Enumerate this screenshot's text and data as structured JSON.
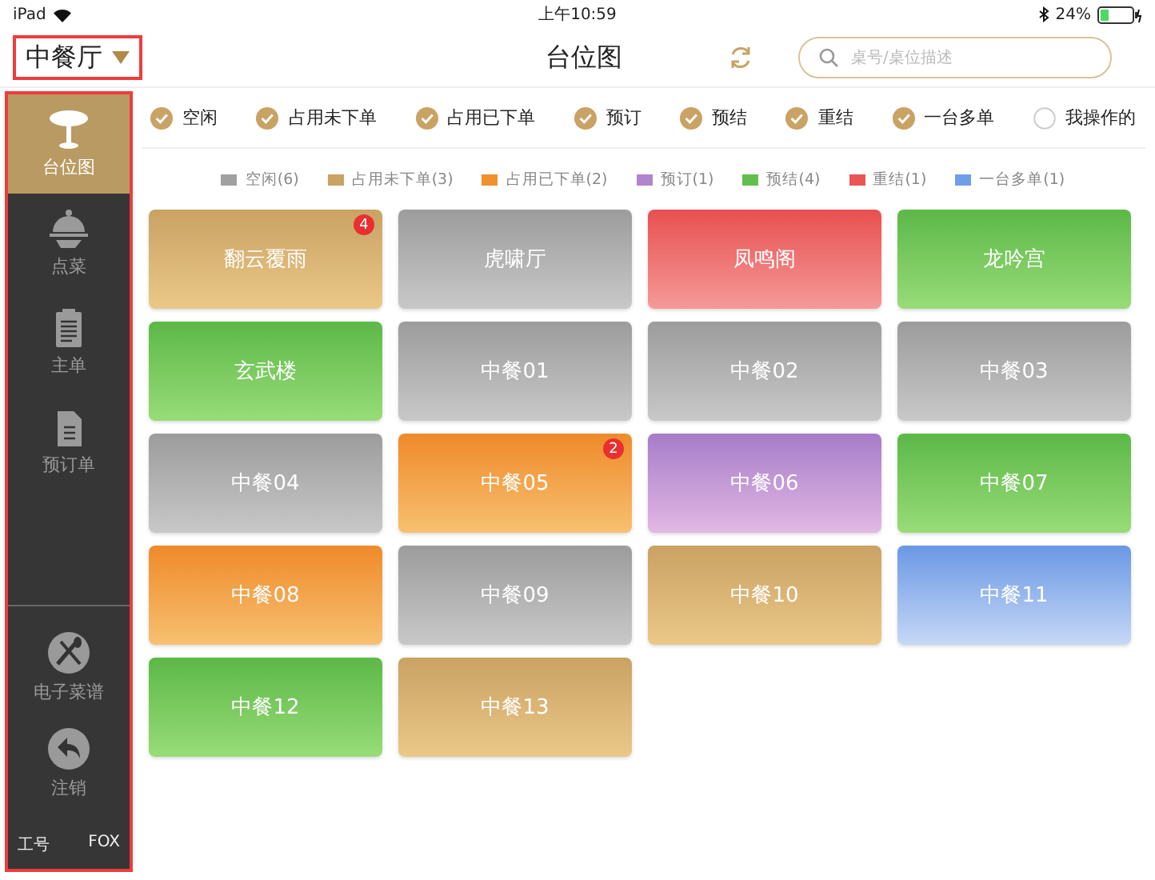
{
  "status_bar": {
    "device": "iPad",
    "time": "上午10:59",
    "battery": "24%"
  },
  "header": {
    "restaurant": "中餐厅",
    "title": "台位图",
    "search": {
      "placeholder": "桌号/桌位描述"
    }
  },
  "sidebar": {
    "items": [
      {
        "label": "台位图",
        "selected": true
      },
      {
        "label": "点菜",
        "selected": false
      },
      {
        "label": "主单",
        "selected": false
      },
      {
        "label": "预订单",
        "selected": false
      }
    ],
    "bottom_items": [
      {
        "label": "电子菜谱"
      },
      {
        "label": "注销"
      }
    ],
    "footer": {
      "label": "工号",
      "user": "FOX"
    }
  },
  "filters": [
    {
      "label": "空闲",
      "checked": true
    },
    {
      "label": "占用未下单",
      "checked": true
    },
    {
      "label": "占用已下单",
      "checked": true
    },
    {
      "label": "预订",
      "checked": true
    },
    {
      "label": "预结",
      "checked": true
    },
    {
      "label": "重结",
      "checked": true
    },
    {
      "label": "一台多单",
      "checked": true
    },
    {
      "label": "我操作的",
      "checked": false
    }
  ],
  "legend": [
    {
      "label": "空闲(6)",
      "color": "#a0a0a0"
    },
    {
      "label": "占用未下单(3)",
      "color": "#c9a264"
    },
    {
      "label": "占用已下单(2)",
      "color": "#f0912e"
    },
    {
      "label": "预订(1)",
      "color": "#b085d0"
    },
    {
      "label": "预结(4)",
      "color": "#62bf4e"
    },
    {
      "label": "重结(1)",
      "color": "#e85555"
    },
    {
      "label": "一台多单(1)",
      "color": "#6f9ee8"
    }
  ],
  "tables": [
    {
      "name": "翻云覆雨",
      "kind": "unordered",
      "badge": "4"
    },
    {
      "name": "虎啸厅",
      "kind": "idle"
    },
    {
      "name": "凤鸣阁",
      "kind": "rebill"
    },
    {
      "name": "龙吟宫",
      "kind": "prebill"
    },
    {
      "name": "玄武楼",
      "kind": "prebill"
    },
    {
      "name": "中餐01",
      "kind": "idle"
    },
    {
      "name": "中餐02",
      "kind": "idle"
    },
    {
      "name": "中餐03",
      "kind": "idle"
    },
    {
      "name": "中餐04",
      "kind": "idle"
    },
    {
      "name": "中餐05",
      "kind": "ordered",
      "badge": "2"
    },
    {
      "name": "中餐06",
      "kind": "reserved"
    },
    {
      "name": "中餐07",
      "kind": "prebill"
    },
    {
      "name": "中餐08",
      "kind": "ordered"
    },
    {
      "name": "中餐09",
      "kind": "idle"
    },
    {
      "name": "中餐10",
      "kind": "unordered"
    },
    {
      "name": "中餐11",
      "kind": "multi"
    },
    {
      "name": "中餐12",
      "kind": "prebill"
    },
    {
      "name": "中餐13",
      "kind": "unordered"
    }
  ]
}
